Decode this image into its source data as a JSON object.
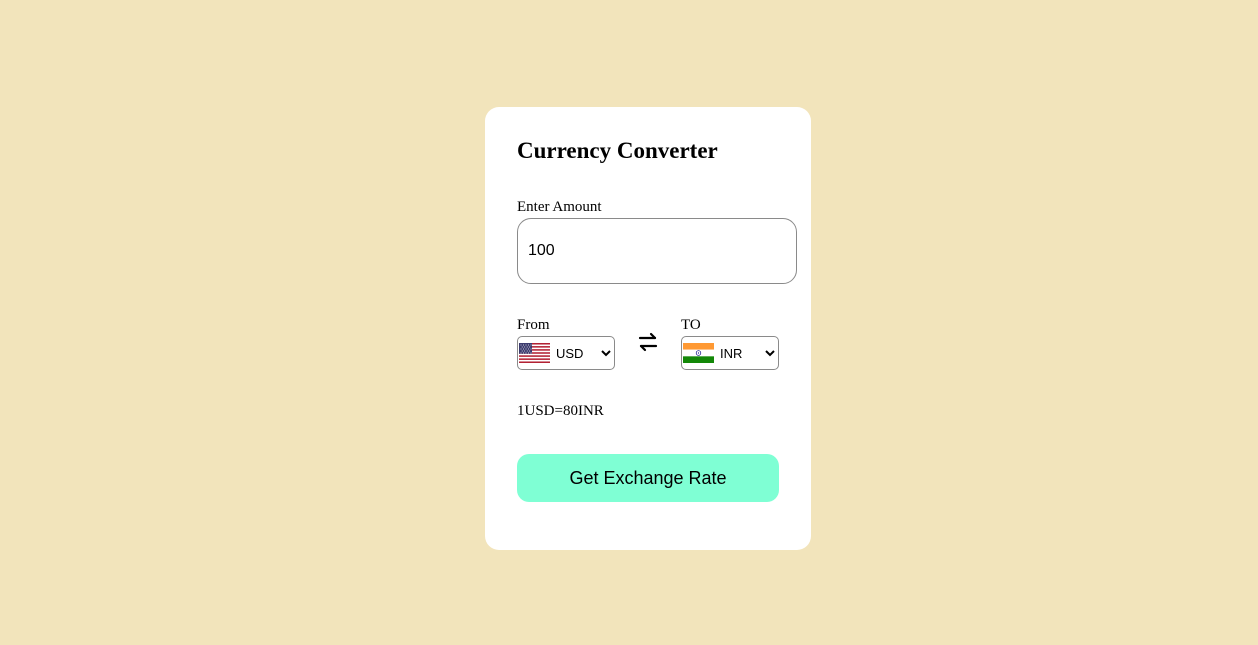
{
  "converter": {
    "title": "Currency Converter",
    "amount_label": "Enter Amount",
    "amount_value": "100",
    "from_label": "From",
    "to_label": "TO",
    "from_currency": "USD",
    "to_currency": "INR",
    "exchange_rate_text": "1USD=80INR",
    "button_label": "Get Exchange Rate"
  },
  "icons": {
    "from_flag": "us-flag-icon",
    "to_flag": "india-flag-icon",
    "swap": "swap-arrows-icon"
  },
  "colors": {
    "page_background": "#f2e4bb",
    "card_background": "#ffffff",
    "button_background": "#7fffd4"
  }
}
